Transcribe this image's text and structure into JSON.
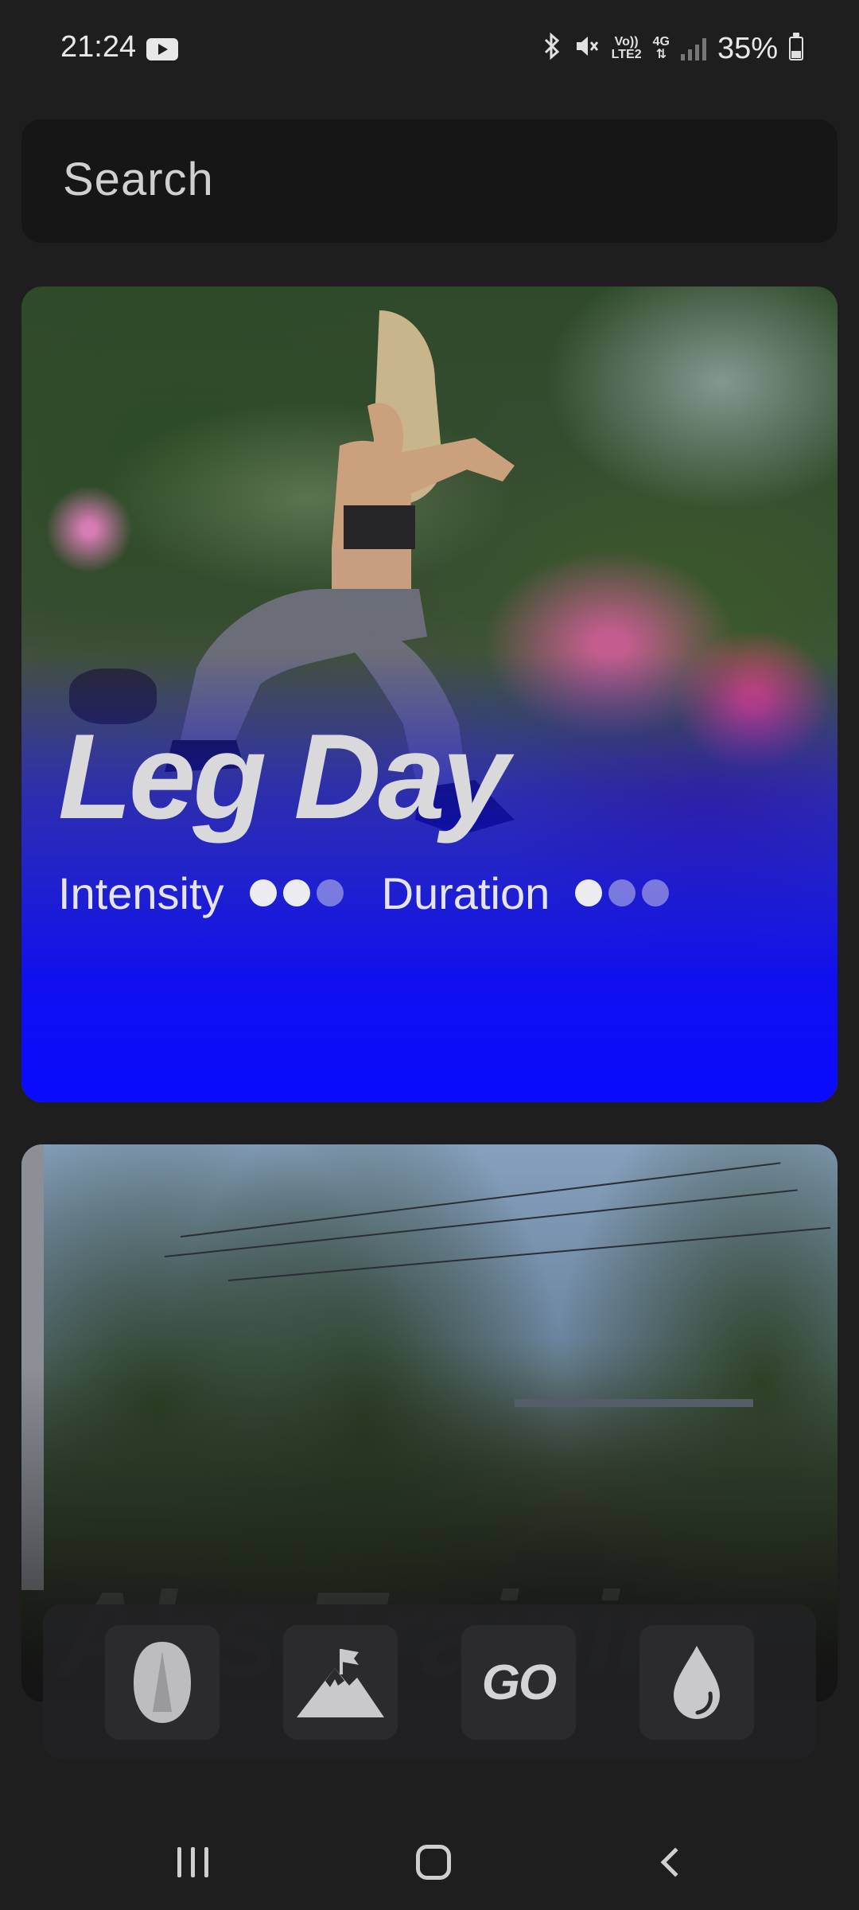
{
  "status_bar": {
    "time": "21:24",
    "network_top": "Vo))",
    "network_bottom": "LTE2",
    "data_type": "4G",
    "battery": "35%",
    "icons": [
      "youtube-icon",
      "bluetooth-icon",
      "mute-icon",
      "volte-icon",
      "4g-data-icon",
      "signal-icon",
      "battery-icon"
    ]
  },
  "search": {
    "placeholder": "Search"
  },
  "workouts": [
    {
      "title": "Leg Day",
      "intensity_label": "Intensity",
      "intensity_level": 2,
      "intensity_max": 3,
      "duration_label": "Duration",
      "duration_level": 1,
      "duration_max": 3,
      "overlay_color": "#0a0aff"
    },
    {
      "title": "Abs Training"
    }
  ],
  "bottom_nav": {
    "items": [
      {
        "icon": "abs-shield-icon"
      },
      {
        "icon": "mountain-flag-icon"
      },
      {
        "label": "GO"
      },
      {
        "icon": "water-drop-icon"
      }
    ]
  },
  "system_nav": [
    "recents-icon",
    "home-icon",
    "back-icon"
  ]
}
